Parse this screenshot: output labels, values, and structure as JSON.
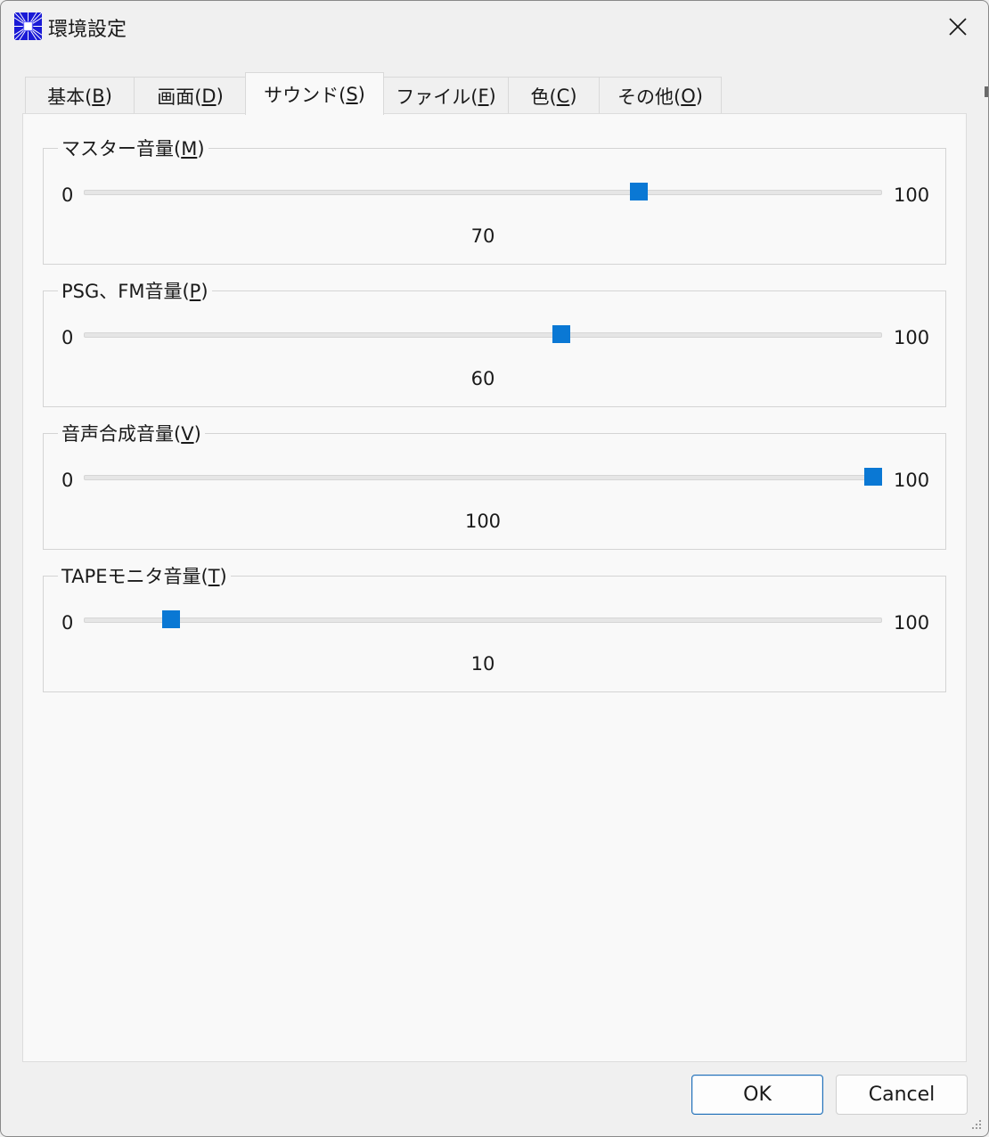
{
  "window": {
    "title": "環境設定"
  },
  "tabs": [
    {
      "label": "基本(",
      "mnemonic": "B",
      "suffix": ")"
    },
    {
      "label": "画面(",
      "mnemonic": "D",
      "suffix": ")"
    },
    {
      "label": "サウンド(",
      "mnemonic": "S",
      "suffix": ")",
      "active": true
    },
    {
      "label": "ファイル(",
      "mnemonic": "F",
      "suffix": ")"
    },
    {
      "label": "色(",
      "mnemonic": "C",
      "suffix": ")"
    },
    {
      "label": "その他(",
      "mnemonic": "O",
      "suffix": ")"
    }
  ],
  "groups": [
    {
      "label": "マスター音量(",
      "mnemonic": "M",
      "suffix": ")",
      "min": "0",
      "max": "100",
      "value": 70,
      "value_text": "70"
    },
    {
      "label": "PSG、FM音量(",
      "mnemonic": "P",
      "suffix": ")",
      "min": "0",
      "max": "100",
      "value": 60,
      "value_text": "60"
    },
    {
      "label": "音声合成音量(",
      "mnemonic": "V",
      "suffix": ")",
      "min": "0",
      "max": "100",
      "value": 100,
      "value_text": "100"
    },
    {
      "label": "TAPEモニタ音量(",
      "mnemonic": "T",
      "suffix": ")",
      "min": "0",
      "max": "100",
      "value": 10,
      "value_text": "10"
    }
  ],
  "buttons": {
    "ok": "OK",
    "cancel": "Cancel"
  },
  "colors": {
    "accent": "#0a78d4",
    "background": "#f0f0f0",
    "panel": "#f9f9f9"
  },
  "icons": {
    "app": "app-icon",
    "close": "close-icon",
    "grip": "resize-grip-icon"
  }
}
